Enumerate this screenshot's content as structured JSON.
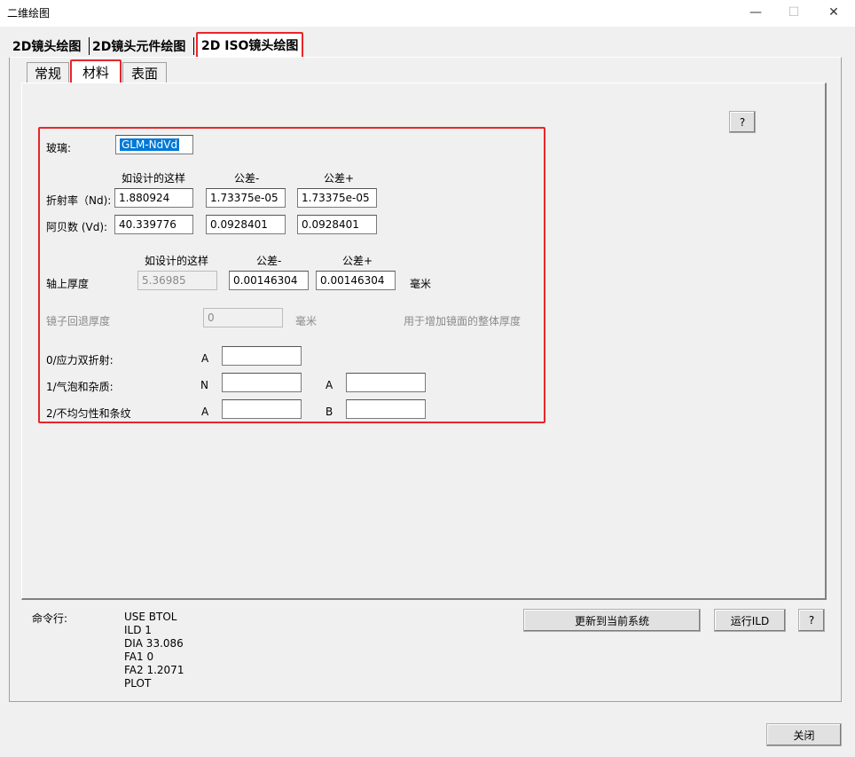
{
  "window": {
    "title": "二维绘图",
    "minimize": "—",
    "maximize": "☐",
    "close": "✕"
  },
  "outer_tabs": [
    "2D镜头绘图",
    "2D镜头元件绘图",
    "2D ISO镜头绘图"
  ],
  "inner_tabs": [
    "常规",
    "材料",
    "表面"
  ],
  "help_label": "?",
  "material": {
    "glass_label": "玻璃:",
    "glass_value": "GLM-NdVd",
    "col_design": "如设计的这样",
    "col_tol_minus": "公差-",
    "col_tol_plus": "公差+",
    "nd_label": "折射率（Nd):",
    "nd_design": "1.880924",
    "nd_minus": "1.73375e-05",
    "nd_plus": "1.73375e-05",
    "vd_label": "阿贝数 (Vd):",
    "vd_design": "40.339776",
    "vd_minus": "0.0928401",
    "vd_plus": "0.0928401"
  },
  "thickness": {
    "col_design": "如设计的这样",
    "col_tol_minus": "公差-",
    "col_tol_plus": "公差+",
    "label": "轴上厚度",
    "design": "5.36985",
    "minus": "0.00146304",
    "plus": "0.00146304",
    "unit": "毫米",
    "mirror_label": "镜子回退厚度",
    "mirror_value": "0",
    "mirror_unit": "毫米",
    "mirror_note": "用于增加镜面的整体厚度"
  },
  "iso": {
    "row0_label": "0/应力双折射:",
    "row0_a_label": "A",
    "row0_a_value": "",
    "row1_label": "1/气泡和杂质:",
    "row1_n_label": "N",
    "row1_n_value": "",
    "row1_a_label": "A",
    "row1_a_value": "",
    "row2_label": "2/不均匀性和条纹",
    "row2_a_label": "A",
    "row2_a_value": "",
    "row2_b_label": "B",
    "row2_b_value": ""
  },
  "command": {
    "label": "命令行:",
    "lines": [
      "USE BTOL",
      "ILD 1",
      "DIA 33.086",
      "FA1 0",
      "FA2 1.2071",
      "PLOT"
    ]
  },
  "buttons": {
    "update": "更新到当前系统",
    "run": "运行ILD",
    "help": "?",
    "close": "关闭"
  },
  "colors": {
    "highlight_red": "#e8262a",
    "selection_blue": "#0078d7"
  }
}
